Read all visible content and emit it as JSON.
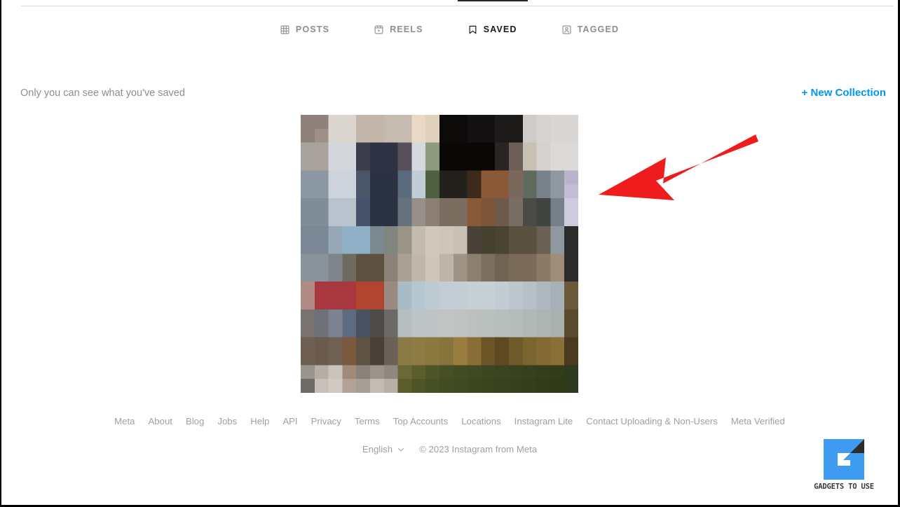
{
  "profile_tabs": {
    "items": [
      {
        "label": "POSTS",
        "icon": "grid-icon",
        "active": false
      },
      {
        "label": "REELS",
        "icon": "reels-icon",
        "active": false
      },
      {
        "label": "SAVED",
        "icon": "bookmark-icon",
        "active": true
      },
      {
        "label": "TAGGED",
        "icon": "tagged-person-icon",
        "active": false
      }
    ]
  },
  "saved_section": {
    "privacy_note": "Only you can see what you've saved",
    "new_collection_label": "+ New Collection",
    "new_collection_color": "#0095f6",
    "saved_items_count": 1
  },
  "saved_grid": {
    "items": [
      {
        "name": "saved-post-thumbnail",
        "alt": "Pixelated saved photo thumbnail",
        "pixelated": true,
        "palette": [
          "#8d817a",
          "#d8d2cc",
          "#c0b4a8",
          "#e9ddcf",
          "#0d0b0a",
          "#3c3d4a",
          "#2b3242",
          "#5a6b7d",
          "#9fb4c4",
          "#6d7b64",
          "#3d2a1c",
          "#8a5a38",
          "#b0462f",
          "#a8373f",
          "#7b8794",
          "#8f9aa2",
          "#c9c2b8",
          "#5a5141",
          "#3f4a22",
          "#2e3a1d"
        ]
      }
    ]
  },
  "annotation": {
    "type": "arrow",
    "color": "#ee1c1c",
    "direction": "down-left",
    "points_to": "saved-post-thumbnail"
  },
  "footer": {
    "links": [
      "Meta",
      "About",
      "Blog",
      "Jobs",
      "Help",
      "API",
      "Privacy",
      "Terms",
      "Top Accounts",
      "Locations",
      "Instagram Lite",
      "Contact Uploading & Non-Users",
      "Meta Verified"
    ],
    "language": "English",
    "copyright": "© 2023 Instagram from Meta"
  },
  "watermark": {
    "text": "GADGETS TO USE",
    "mark_letter": "G",
    "color": "#3d9bf0"
  }
}
